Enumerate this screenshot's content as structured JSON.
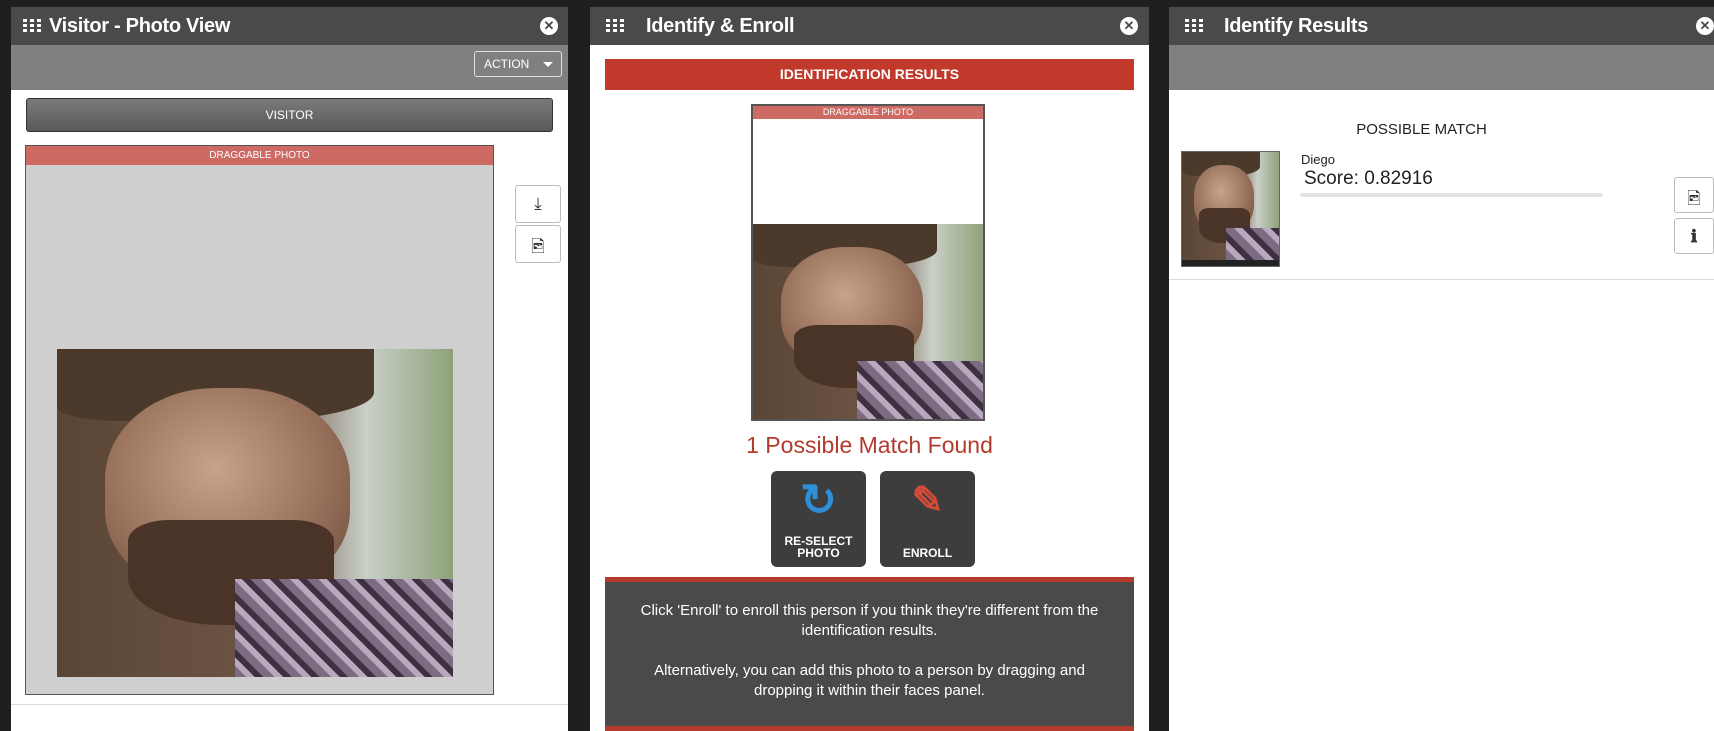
{
  "visitor_panel": {
    "title": "Visitor - Photo View",
    "action_label": "ACTION",
    "visitor_label": "VISITOR",
    "photo_header": "DRAGGABLE PHOTO"
  },
  "identify_panel": {
    "title": "Identify & Enroll",
    "results_header": "IDENTIFICATION RESULTS",
    "photo_header": "DRAGGABLE PHOTO",
    "match_count_text": "1 Possible Match Found",
    "reselect_label_line1": "RE-SELECT",
    "reselect_label_line2": "PHOTO",
    "enroll_label": "ENROLL",
    "info_text_1": "Click 'Enroll' to enroll this person if you think they're different from the identification results.",
    "info_text_2": "Alternatively, you can add this photo to a person by dragging and dropping it within their faces panel.",
    "accent_color": "#c0392b",
    "reselect_icon_color": "#2e8fd8",
    "enroll_icon_color": "#d64a3a"
  },
  "results_panel": {
    "title": "Identify Results",
    "section_header": "POSSIBLE MATCH",
    "match_name": "Diego",
    "match_score": "Score: 0.82916"
  },
  "icons": {
    "grid": "grid-icon",
    "close": "close-icon",
    "download": "download-icon",
    "image": "image-icon",
    "refresh": "refresh-icon",
    "pencil": "pencil-icon",
    "info": "info-icon"
  }
}
